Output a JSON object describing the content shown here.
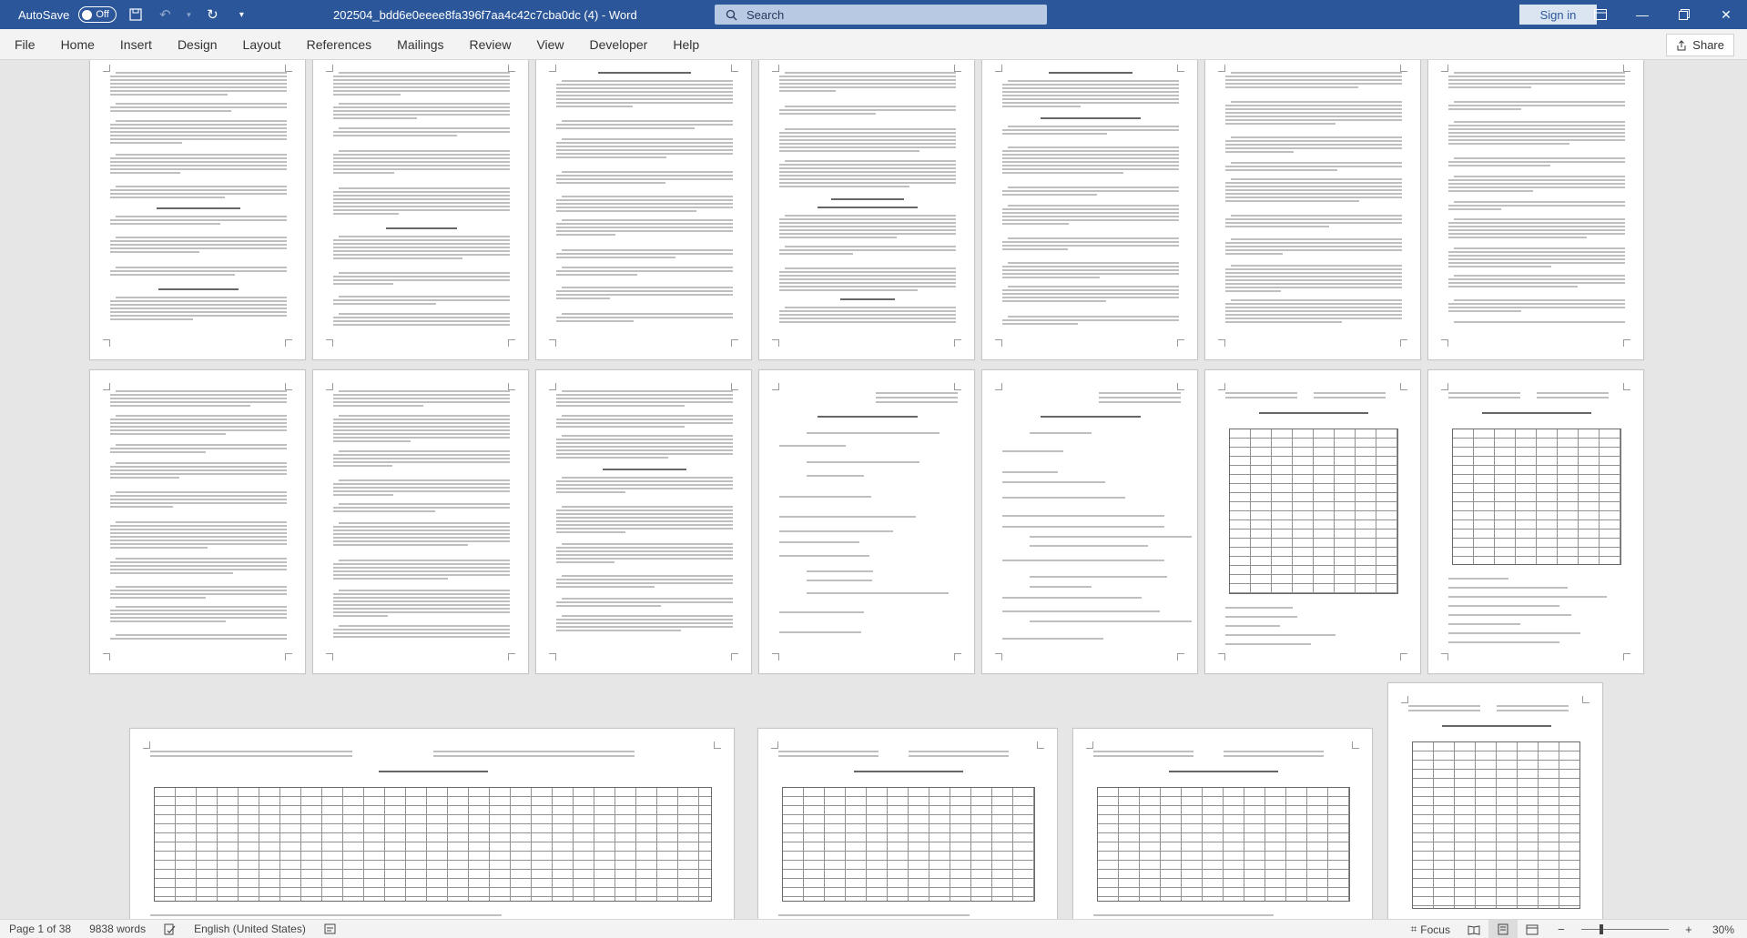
{
  "window": {
    "autosave_label": "AutoSave",
    "autosave_state": "Off",
    "doc_title": "202504_bdd6e0eeee8fa396f7aa4c42c7cba0dc (4)  -  Word",
    "search_placeholder": "Search",
    "signin_label": "Sign in"
  },
  "menu": {
    "items": [
      "File",
      "Home",
      "Insert",
      "Design",
      "Layout",
      "References",
      "Mailings",
      "Review",
      "View",
      "Developer",
      "Help"
    ],
    "share_label": "Share"
  },
  "status": {
    "page": "Page 1 of 38",
    "words": "9838 words",
    "language": "English (United States)",
    "focus": "Focus",
    "zoom": "30%"
  },
  "icons": {
    "save": "save-icon",
    "undo": "undo-icon",
    "redo": "redo-icon",
    "search": "search-icon",
    "share": "share-icon",
    "focus": "focus-icon"
  },
  "colors": {
    "title_bar": "#2b579a",
    "ribbon_bg": "#f3f3f3",
    "workspace_bg": "#e6e6e6",
    "page_bg": "#ffffff"
  }
}
